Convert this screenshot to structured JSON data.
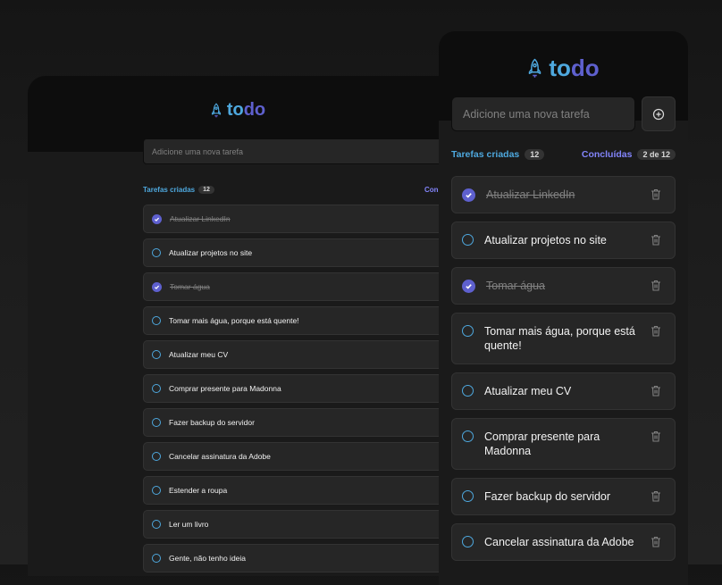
{
  "app": {
    "logo_left": "to",
    "logo_right": "do"
  },
  "input": {
    "placeholder": "Adicione uma nova tarefa"
  },
  "info": {
    "created_label": "Tarefas criadas",
    "created_count": "12",
    "done_label": "Concluídas",
    "done_label_truncated": "Con",
    "done_count": "2 de 12"
  },
  "desktop_tasks": [
    {
      "text": "Atualizar LinkedIn",
      "done": true
    },
    {
      "text": "Atualizar projetos no site",
      "done": false
    },
    {
      "text": "Tomar água",
      "done": true
    },
    {
      "text": "Tomar mais água, porque está quente!",
      "done": false
    },
    {
      "text": "Atualizar meu CV",
      "done": false
    },
    {
      "text": "Comprar presente para Madonna",
      "done": false
    },
    {
      "text": "Fazer backup do servidor",
      "done": false
    },
    {
      "text": "Cancelar assinatura da Adobe",
      "done": false
    },
    {
      "text": "Estender a roupa",
      "done": false
    },
    {
      "text": "Ler um livro",
      "done": false
    },
    {
      "text": "Gente, não tenho ideia",
      "done": false
    }
  ],
  "mobile_tasks": [
    {
      "text": "Atualizar LinkedIn",
      "done": true
    },
    {
      "text": "Atualizar projetos no site",
      "done": false
    },
    {
      "text": "Tomar água",
      "done": true
    },
    {
      "text": "Tomar mais água, porque está quente!",
      "done": false
    },
    {
      "text": "Atualizar meu CV",
      "done": false
    },
    {
      "text": "Comprar presente para Madonna",
      "done": false
    },
    {
      "text": "Fazer backup do servidor",
      "done": false
    },
    {
      "text": "Cancelar assinatura da Adobe",
      "done": false
    }
  ],
  "colors": {
    "blue": "#4EA8DE",
    "purple": "#5E60CE",
    "purple_light": "#8284FA"
  },
  "icons": {
    "logo": "rocket-icon",
    "add": "plus-circle-icon",
    "delete": "trash-icon",
    "checked": "check-icon"
  }
}
